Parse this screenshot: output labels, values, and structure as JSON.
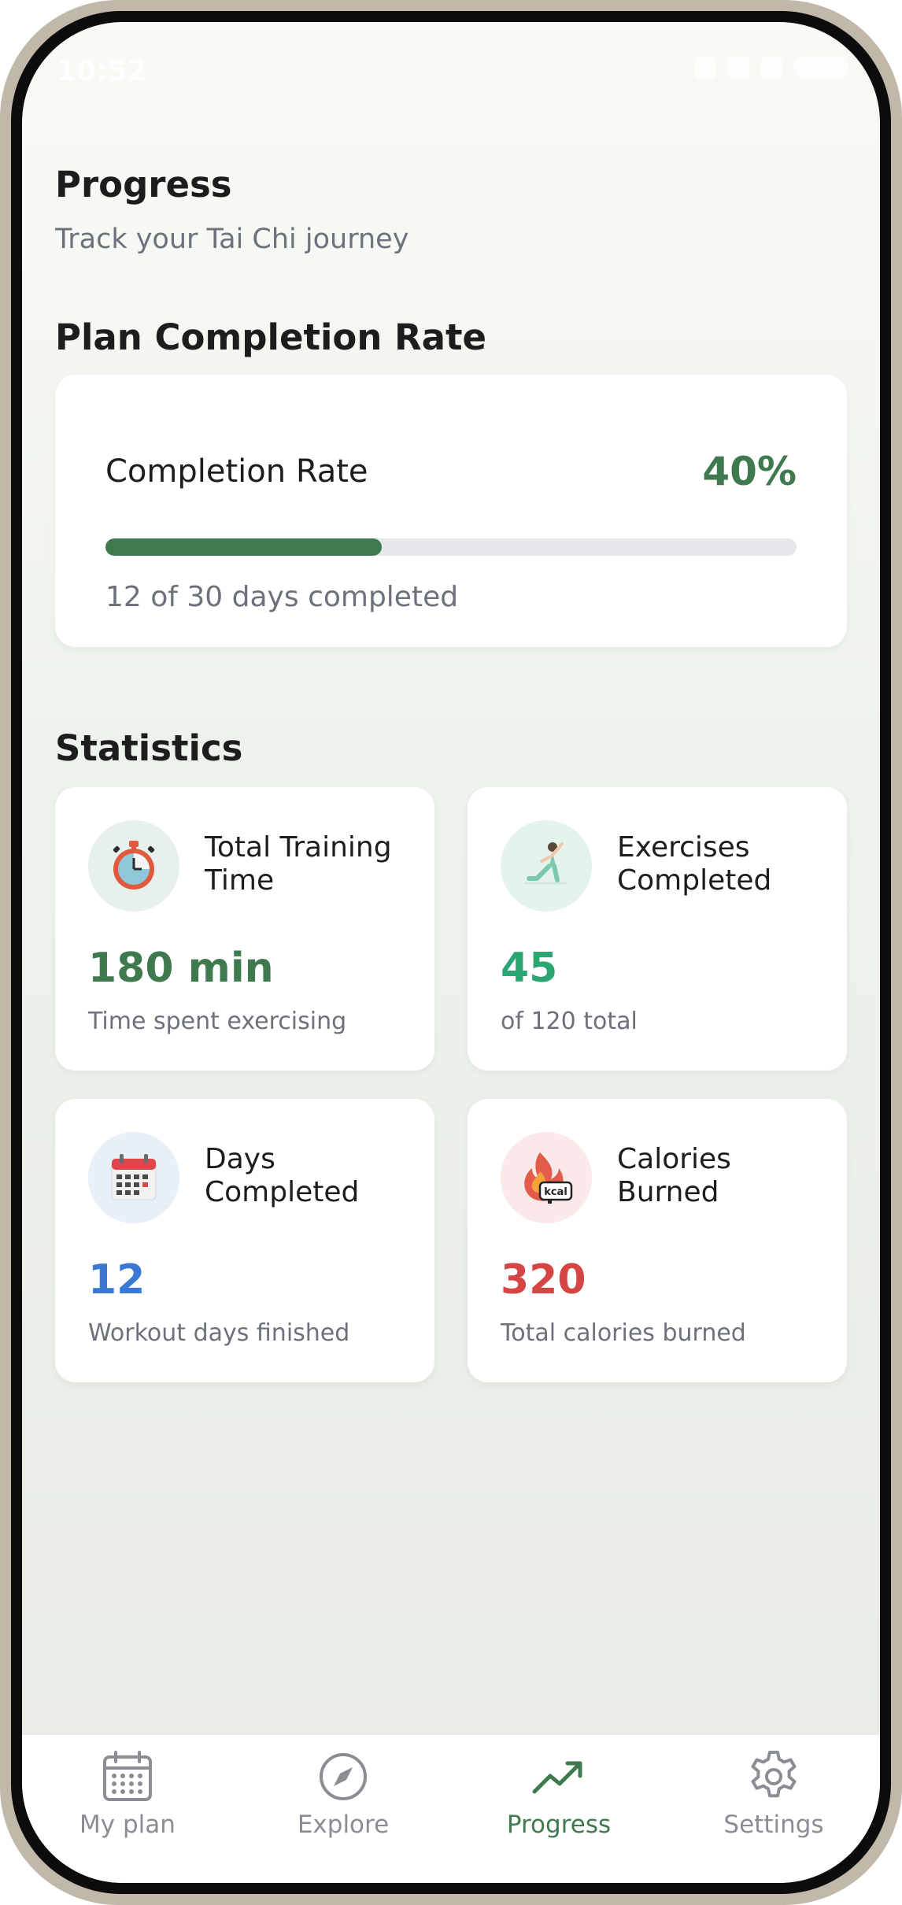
{
  "status_bar": {
    "time": "10:52"
  },
  "header": {
    "title": "Progress",
    "subtitle": "Track your Tai Chi journey"
  },
  "plan_completion": {
    "section_title": "Plan Completion Rate",
    "label": "Completion Rate",
    "percent_text": "40%",
    "progress_fraction": 0.4,
    "days_text": "12 of 30 days completed"
  },
  "statistics": {
    "section_title": "Statistics",
    "cards": [
      {
        "title": "Total Training Time",
        "value": "180 min",
        "description": "Time spent exercising",
        "icon": "stopwatch-icon",
        "value_color": "#3f7a4f",
        "icon_bg": "#e7f0ea"
      },
      {
        "title": "Exercises Completed",
        "value": "45",
        "description": "of 120 total",
        "icon": "yoga-pose-icon",
        "value_color": "#2aa673",
        "icon_bg": "#e4f3ec"
      },
      {
        "title": "Days Completed",
        "value": "12",
        "description": "Workout days finished",
        "icon": "calendar-icon",
        "value_color": "#3b78d4",
        "icon_bg": "#e8eff9"
      },
      {
        "title": "Calories Burned",
        "value": "320",
        "description": "Total calories burned",
        "icon": "kcal-flame-icon",
        "icon_text": "kcal",
        "value_color": "#d64545",
        "icon_bg": "#fbe9e9"
      }
    ]
  },
  "nav": {
    "items": [
      {
        "label": "My plan",
        "icon": "calendar-grid-icon",
        "active": false
      },
      {
        "label": "Explore",
        "icon": "compass-icon",
        "active": false
      },
      {
        "label": "Progress",
        "icon": "trending-up-icon",
        "active": true
      },
      {
        "label": "Settings",
        "icon": "gear-icon",
        "active": false
      }
    ],
    "active_color": "#3f7a4f",
    "inactive_color": "#8a8d93"
  }
}
